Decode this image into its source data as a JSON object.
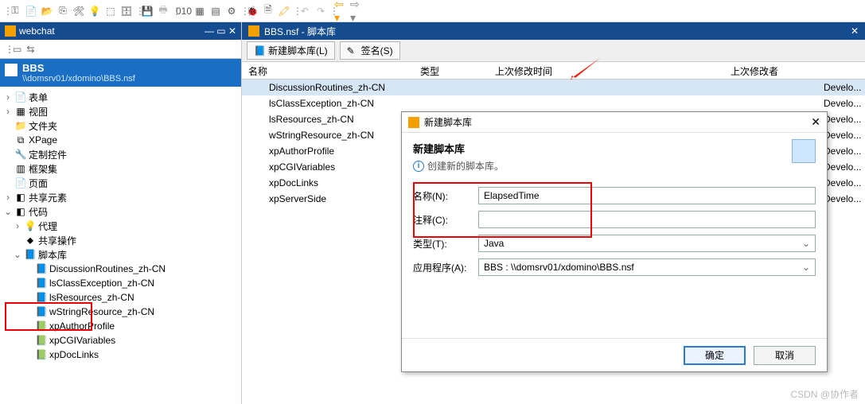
{
  "left_panel": {
    "title": "webchat",
    "bbs": {
      "title": "BBS",
      "path": "\\\\domsrv01/xdomino\\BBS.nsf"
    },
    "tree": [
      {
        "label": "表单",
        "icon": "📄",
        "tw": "›",
        "ind": 0
      },
      {
        "label": "视图",
        "icon": "▦",
        "tw": "›",
        "ind": 0
      },
      {
        "label": "文件夹",
        "icon": "📁",
        "tw": "",
        "ind": 0
      },
      {
        "label": "XPage",
        "icon": "⧉",
        "tw": "",
        "ind": 0
      },
      {
        "label": "定制控件",
        "icon": "🔧",
        "tw": "",
        "ind": 0
      },
      {
        "label": "框架集",
        "icon": "▥",
        "tw": "",
        "ind": 0
      },
      {
        "label": "页面",
        "icon": "📄",
        "tw": "",
        "ind": 0
      },
      {
        "label": "共享元素",
        "icon": "◧",
        "tw": "›",
        "ind": 0
      },
      {
        "label": "代码",
        "icon": "◧",
        "tw": "⌄",
        "ind": 0
      },
      {
        "label": "代理",
        "icon": "💡",
        "tw": "›",
        "ind": 1
      },
      {
        "label": "共享操作",
        "icon": "⬥",
        "tw": "",
        "ind": 1
      },
      {
        "label": "脚本库",
        "icon": "📘",
        "tw": "⌄",
        "ind": 1
      },
      {
        "label": "DiscussionRoutines_zh-CN",
        "icon": "📘",
        "tw": "",
        "ind": 2
      },
      {
        "label": "lsClassException_zh-CN",
        "icon": "📘",
        "tw": "",
        "ind": 2
      },
      {
        "label": "lsResources_zh-CN",
        "icon": "📘",
        "tw": "",
        "ind": 2
      },
      {
        "label": "wStringResource_zh-CN",
        "icon": "📘",
        "tw": "",
        "ind": 2
      },
      {
        "label": "xpAuthorProfile",
        "icon": "📗",
        "tw": "",
        "ind": 2
      },
      {
        "label": "xpCGIVariables",
        "icon": "📗",
        "tw": "",
        "ind": 2
      },
      {
        "label": "xpDocLinks",
        "icon": "📗",
        "tw": "",
        "ind": 2
      }
    ]
  },
  "right_panel": {
    "title": "BBS.nsf - 脚本库",
    "toolbar": {
      "new_lib": "新建脚本库(L)",
      "sign": "签名(S)"
    },
    "columns": {
      "name": "名称",
      "type": "类型",
      "modified": "上次修改时间",
      "modifier": "上次修改者"
    },
    "rows": [
      {
        "name": "DiscussionRoutines_zh-CN",
        "dev": "Develo..."
      },
      {
        "name": "lsClassException_zh-CN",
        "dev": "Develo..."
      },
      {
        "name": "lsResources_zh-CN",
        "dev": "Develo..."
      },
      {
        "name": "wStringResource_zh-CN",
        "dev": "Develo..."
      },
      {
        "name": "xpAuthorProfile",
        "dev": "Develo..."
      },
      {
        "name": "xpCGIVariables",
        "dev": "Develo..."
      },
      {
        "name": "xpDocLinks",
        "dev": "Develo..."
      },
      {
        "name": "xpServerSide",
        "dev": "Develo..."
      }
    ]
  },
  "dialog": {
    "title": "新建脚本库",
    "heading": "新建脚本库",
    "sub": "创建新的脚本库。",
    "name_label": "名称(N):",
    "name_value": "ElapsedTime",
    "comment_label": "注释(C):",
    "comment_value": "",
    "type_label": "类型(T):",
    "type_value": "Java",
    "app_label": "应用程序(A):",
    "app_value": "BBS : \\\\domsrv01/xdomino\\BBS.nsf",
    "ok": "确定",
    "cancel": "取消"
  },
  "watermark": "CSDN @协作者"
}
